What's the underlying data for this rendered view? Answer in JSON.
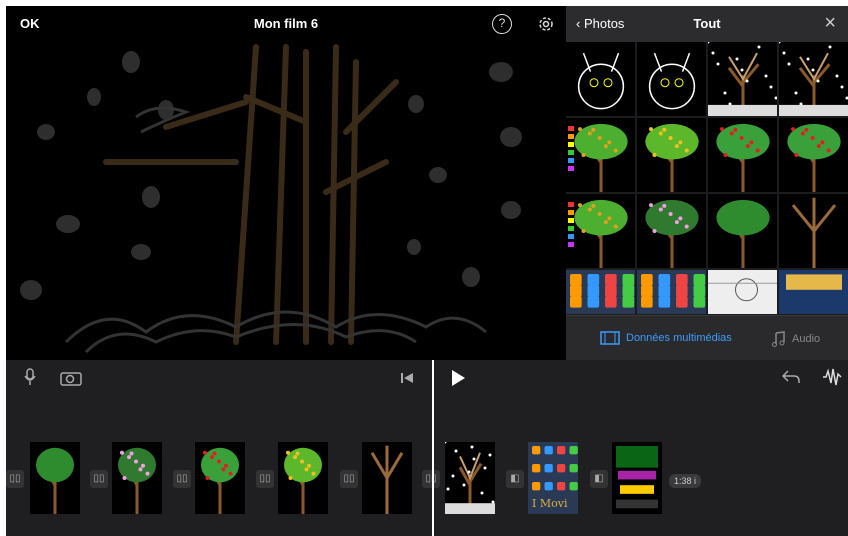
{
  "header": {
    "done_label": "OK",
    "title": "Mon film 6",
    "help_glyph": "?"
  },
  "browser": {
    "back_label": "Photos",
    "title": "Tout",
    "close_glyph": "×",
    "tabs": {
      "media_label": "Données multimédias",
      "audio_label": "Audio"
    },
    "thumbnails": [
      "cat-drawing",
      "cat-drawing",
      "winter-tree",
      "winter-tree",
      "green-tree-palette",
      "green-tree-fruit",
      "green-tree-red",
      "green-tree-red",
      "green-tree-palette",
      "pink-blossom-tree",
      "green-tree",
      "bare-tree",
      "home-screen",
      "home-screen",
      "sketch",
      "app-store"
    ]
  },
  "timeline": {
    "clip_duration": "1:38 i",
    "clip_caption": "I Movi",
    "clips": [
      "green-tree",
      "pink-blossom-tree",
      "green-tree-red",
      "green-tree-fruit",
      "bare-tree",
      "winter-tree",
      "home-screen",
      "neon-draw"
    ]
  },
  "colors": {
    "accent": "#3a9cff",
    "background": "#000000",
    "panel": "#1f1f21"
  }
}
